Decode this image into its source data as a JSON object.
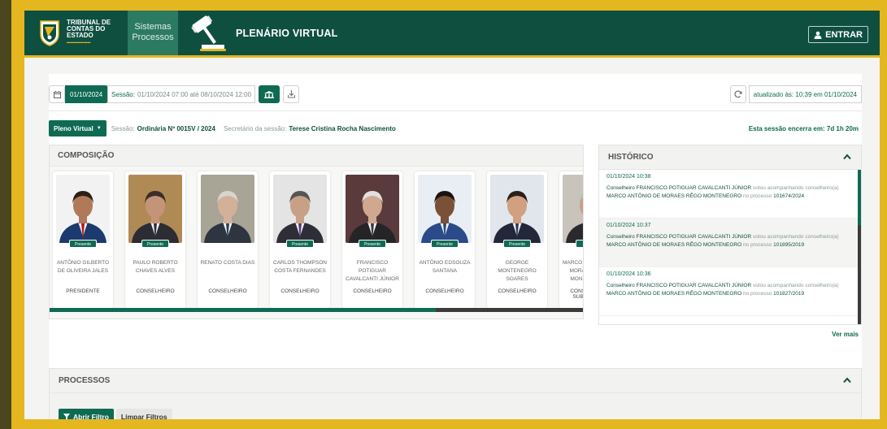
{
  "colors": {
    "brand": "#0f6a53",
    "header": "#0f4f40",
    "gold": "#e4b720"
  },
  "header": {
    "logo_lines": [
      "TRIBUNAL DE",
      "CONTAS DO",
      "ESTADO"
    ],
    "nav_lines": [
      "Sistemas",
      "Processos"
    ],
    "title": "PLENÁRIO VIRTUAL",
    "login_label": "ENTRAR"
  },
  "toolbar": {
    "date": "01/10/2024",
    "session_label": "Sessão:",
    "session_range": "01/10/2024 07:00 até 08/10/2024 12:00",
    "updated": "atualizado às: 10:39 em 01/10/2024"
  },
  "session": {
    "pleno_label": "Pleno Virtual",
    "sessao_label": "Sessão:",
    "sessao_value": "Ordinária Nº 0015V / 2024",
    "secretario_label": "Secretário da sessão:",
    "secretario_value": "Terese Cristina Rocha Nascimento",
    "encerra": "Esta sessão encerra em: 7d 1h 20m"
  },
  "composicao": {
    "title": "COMPOSIÇÃO",
    "members": [
      {
        "name": "ANTÔNIO GILBERTO DE OLIVEIRA JALES",
        "role": "PRESIDENTE",
        "badge": "Presente",
        "tie": "#b01818",
        "suit": "#1d3a6e",
        "skin": "#b07a5a",
        "hair": "#2a2018",
        "bg": "#f2f2f2"
      },
      {
        "name": "PAULO ROBERTO CHAVES ALVES",
        "role": "CONSELHEIRO",
        "badge": "Presente",
        "tie": "#2a3040",
        "suit": "#2c2c34",
        "skin": "#c49478",
        "hair": "#3a2e28",
        "bg": "#b08a55"
      },
      {
        "name": "RENATO COSTA DIAS",
        "role": "CONSELHEIRO",
        "badge": "",
        "tie": "#2a4060",
        "suit": "#2e3440",
        "skin": "#d3b09a",
        "hair": "#d8d4d0",
        "bg": "#a8a496"
      },
      {
        "name": "CARLOS THOMPSON COSTA FERNANDES",
        "role": "CONSELHEIRO",
        "badge": "Presente",
        "tie": "#5a3a7a",
        "suit": "#2e2e38",
        "skin": "#c8a088",
        "hair": "#555",
        "bg": "#e4e4e4"
      },
      {
        "name": "FRANCISCO POTIGUAR CAVALCANTI JÚNIOR",
        "role": "CONSELHEIRO",
        "badge": "Presente",
        "tie": "#3a3a3a",
        "suit": "#252528",
        "skin": "#d0a890",
        "hair": "#e0e0e0",
        "bg": "#5a3a3a"
      },
      {
        "name": "ANTÔNIO EDSOUZA SANTANA",
        "role": "CONSELHEIRO",
        "badge": "Presente",
        "tie": "#2a4a80",
        "suit": "#2a4a8a",
        "skin": "#7a5038",
        "hair": "#1a1410",
        "bg": "#e8eef4"
      },
      {
        "name": "GEORGE MONTENEGRO SOARES",
        "role": "CONSELHEIRO",
        "badge": "Presente",
        "tie": "#2a3a60",
        "suit": "#22283a",
        "skin": "#d0a080",
        "hair": "#2a2018",
        "bg": "#e0e6ec"
      },
      {
        "name": "MARCO ANTÔNIO DE MORAES RÊGO MONTENEGRO",
        "role": "CONSELHEIRO SUBSTITUTO",
        "badge": "P",
        "tie": "#333",
        "suit": "#2a2a2e",
        "skin": "#c8a088",
        "hair": "#bbb",
        "bg": "#c8c4bc"
      }
    ]
  },
  "historico": {
    "title": "HISTÓRICO",
    "items": [
      {
        "date": "01/10/2024 10:38",
        "who": "Conselheiro FRANCISCO POTIGUAR CAVALCANTI JÚNIOR",
        "verb": "votou acompanhando",
        "pre": "conselheiro(a)",
        "whom": "MARCO ANTÔNIO DE MORAES RÊGO MONTENEGRO",
        "mid": "no processo",
        "proc": "101674/2024"
      },
      {
        "date": "01/10/2024 10:37",
        "who": "Conselheiro FRANCISCO POTIGUAR CAVALCANTI JÚNIOR",
        "verb": "votou acompanhando",
        "pre": "conselheiro(a)",
        "whom": "MARCO ANTÔNIO DE MORAES RÊGO MONTENEGRO",
        "mid": "no processo",
        "proc": "101895/2019"
      },
      {
        "date": "01/10/2024 10:36",
        "who": "Conselheiro FRANCISCO POTIGUAR CAVALCANTI JÚNIOR",
        "verb": "votou acompanhando",
        "pre": "conselheiro(a)",
        "whom": "MARCO ANTÔNIO DE MORAES RÊGO MONTENEGRO",
        "mid": "no processo",
        "proc": "101827/2019"
      }
    ],
    "more": "Ver mais"
  },
  "processos": {
    "title": "PROCESSOS",
    "open_filter": "Abrir Filtro",
    "clear_filter": "Limpar Filtros"
  }
}
